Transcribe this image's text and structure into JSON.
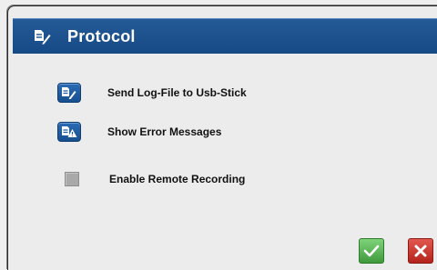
{
  "dialog": {
    "title": "Protocol",
    "title_icon": "document-edit-icon"
  },
  "items": [
    {
      "label": "Send Log-File to Usb-Stick",
      "icon": "document-edit-icon"
    },
    {
      "label": "Show Error Messages",
      "icon": "document-warning-icon"
    }
  ],
  "remote_recording": {
    "label": "Enable Remote Recording",
    "checked": false
  },
  "actions": {
    "ok_icon": "checkmark-icon",
    "cancel_icon": "close-icon"
  },
  "colors": {
    "titlebar": "#1b4f8c",
    "ok": "#56b052",
    "cancel": "#c7322a"
  }
}
